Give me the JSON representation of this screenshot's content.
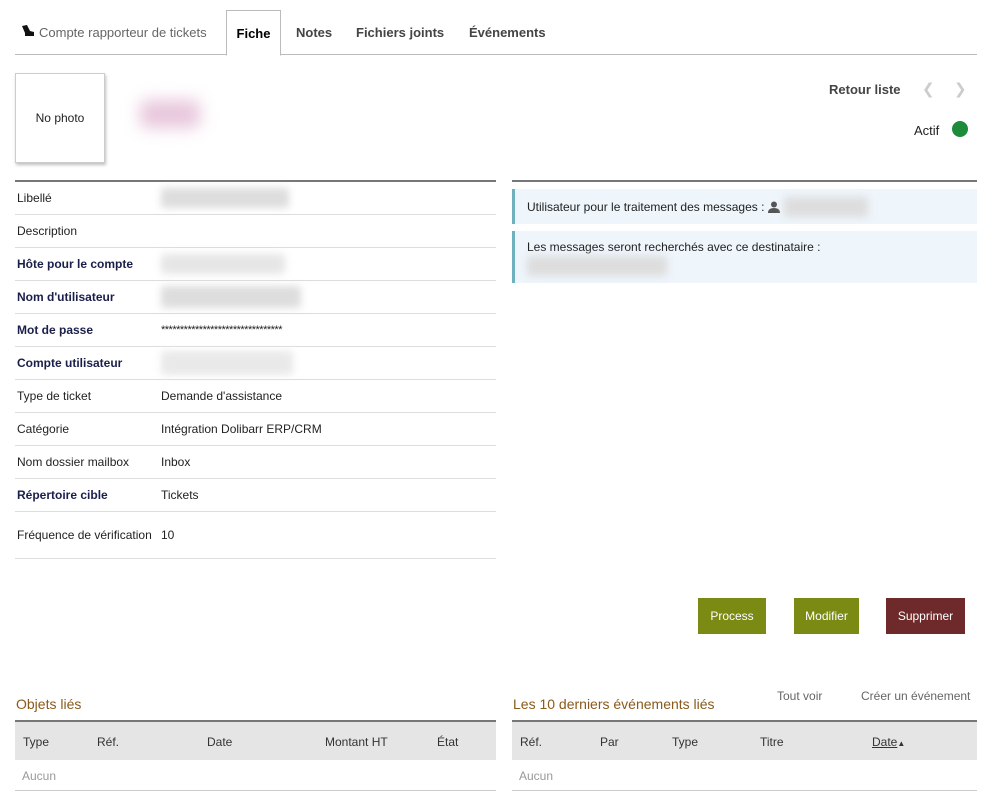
{
  "tabs": [
    {
      "label": "Compte rapporteur de tickets",
      "icon": "ticket-icon"
    },
    {
      "label": "Fiche"
    },
    {
      "label": "Notes"
    },
    {
      "label": "Fichiers joints"
    },
    {
      "label": "Événements"
    }
  ],
  "header": {
    "photo_placeholder": "No photo",
    "back_to_list": "Retour liste",
    "prev_icon": "chevron-left-icon",
    "next_icon": "chevron-right-icon",
    "status_label": "Actif",
    "status_color": "#1e8b3b"
  },
  "fields": [
    {
      "label": "Libellé",
      "value": ""
    },
    {
      "label": "Description",
      "value": ""
    },
    {
      "label": "Hôte pour le compte",
      "value": ""
    },
    {
      "label": "Nom d'utilisateur",
      "value": ""
    },
    {
      "label": "Mot de passe",
      "value": "********************************"
    },
    {
      "label": "Compte utilisateur",
      "value": ""
    },
    {
      "label": "Type de ticket",
      "value": "Demande d'assistance"
    },
    {
      "label": "Catégorie",
      "value": "Intégration Dolibarr ERP/CRM"
    },
    {
      "label": "Nom dossier mailbox",
      "value": "Inbox"
    },
    {
      "label": "Répertoire cible",
      "value": "Tickets"
    },
    {
      "label": "Fréquence de vérification",
      "value": "10"
    }
  ],
  "info_boxes": [
    {
      "text": "Utilisateur pour le traitement des messages :"
    },
    {
      "text": "Les messages seront recherchés avec ce destinataire :"
    }
  ],
  "actions": {
    "process": "Process",
    "modify": "Modifier",
    "delete": "Supprimer",
    "green": "#7a8a12",
    "red": "#6e2a2a"
  },
  "linked_objects": {
    "title": "Objets liés",
    "columns": [
      "Type",
      "Réf.",
      "Date",
      "Montant HT",
      "État"
    ],
    "empty": "Aucun"
  },
  "events": {
    "title": "Les 10 derniers événements liés",
    "see_all": "Tout voir",
    "create": "Créer un événement",
    "columns": [
      "Réf.",
      "Par",
      "Type",
      "Titre",
      "Date"
    ],
    "empty": "Aucun"
  }
}
